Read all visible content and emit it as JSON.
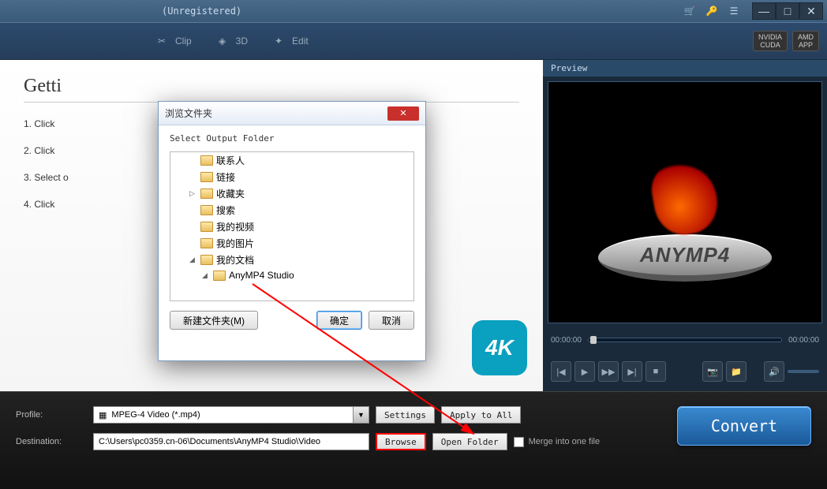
{
  "window": {
    "title": "(Unregistered)"
  },
  "toolbar": {
    "clip": "Clip",
    "three_d": "3D",
    "edit": "Edit",
    "badge1_top": "NVIDIA",
    "badge1_bot": "CUDA",
    "badge2_top": "AMD",
    "badge2_bot": "APP"
  },
  "left": {
    "heading": "Getti",
    "step1": "1. Click",
    "step2": "2. Click",
    "step3": "3. Select o",
    "step4": "4. Click",
    "fk_logo": "4K"
  },
  "preview": {
    "label": "Preview",
    "logo_text": "ANYMP4",
    "time_start": "00:00:00",
    "time_end": "00:00:00"
  },
  "bottom": {
    "profile_label": "Profile:",
    "profile_value": "MPEG-4 Video (*.mp4)",
    "settings": "Settings",
    "apply_all": "Apply to All",
    "dest_label": "Destination:",
    "dest_value": "C:\\Users\\pc0359.cn-06\\Documents\\AnyMP4 Studio\\Video",
    "browse": "Browse",
    "open_folder": "Open Folder",
    "merge": "Merge into one file",
    "convert": "Convert"
  },
  "dialog": {
    "title": "浏览文件夹",
    "subtitle": "Select Output Folder",
    "items": [
      {
        "label": "联系人",
        "indent": 1,
        "expander": ""
      },
      {
        "label": "链接",
        "indent": 1,
        "expander": ""
      },
      {
        "label": "收藏夹",
        "indent": 1,
        "expander": "▷"
      },
      {
        "label": "搜索",
        "indent": 1,
        "expander": ""
      },
      {
        "label": "我的视频",
        "indent": 1,
        "expander": ""
      },
      {
        "label": "我的图片",
        "indent": 1,
        "expander": ""
      },
      {
        "label": "我的文档",
        "indent": 1,
        "expander": "◢"
      },
      {
        "label": "AnyMP4 Studio",
        "indent": 2,
        "expander": "◢"
      }
    ],
    "new_folder": "新建文件夹(M)",
    "ok": "确定",
    "cancel": "取消",
    "close_x": "✕"
  }
}
